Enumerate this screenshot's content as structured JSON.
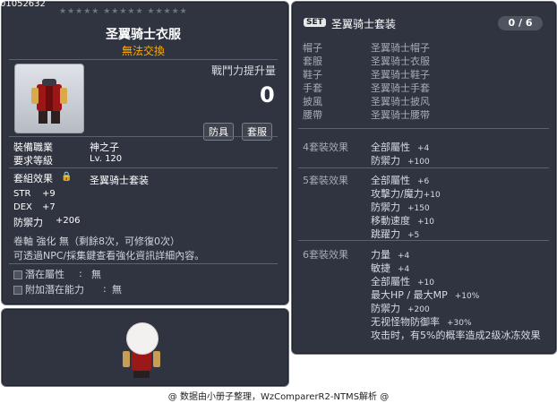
{
  "item": {
    "id": "01052632",
    "title": "圣翼骑士衣服",
    "trade": "無法交換",
    "power_label": "戰鬥力提升量",
    "power_value": "0",
    "chips": [
      "防具",
      "套服"
    ],
    "job_label": "裝備職業",
    "job_value": "神之子",
    "level_label": "要求等級",
    "level_value": "Lv. 120",
    "set_label": "套組效果",
    "set_value": "圣翼骑士套装",
    "stats": [
      {
        "name": "STR",
        "value": "+9"
      },
      {
        "name": "DEX",
        "value": "+7"
      },
      {
        "name": "防禦力",
        "value": "+206"
      }
    ],
    "scroll_line": "卷軸 強化 無（剩餘8次，可修復0次）",
    "npc_line": "可透過NPC/採集鍵查看強化資訊詳細內容。",
    "potential": [
      {
        "label": "潛在屬性",
        "value": "無"
      },
      {
        "label": "附加潛在能力",
        "value": "無"
      }
    ]
  },
  "set": {
    "badge": "SET",
    "title": "圣翼骑士套装",
    "count": "0 / 6",
    "pieces": [
      {
        "slot": "帽子",
        "name": "圣翼骑士帽子"
      },
      {
        "slot": "套服",
        "name": "圣翼骑士衣服"
      },
      {
        "slot": "鞋子",
        "name": "圣翼骑士鞋子"
      },
      {
        "slot": "手套",
        "name": "圣翼骑士手套"
      },
      {
        "slot": "披風",
        "name": "圣翼骑士披风"
      },
      {
        "slot": "腰帶",
        "name": "圣翼骑士腰带"
      }
    ],
    "effects": [
      {
        "head": "4套裝效果",
        "rows": [
          {
            "name": "全部屬性",
            "value": "+4"
          },
          {
            "name": "防禦力",
            "value": "+100"
          }
        ]
      },
      {
        "head": "5套裝效果",
        "rows": [
          {
            "name": "全部屬性",
            "value": "+6"
          },
          {
            "name": "攻擊力/魔力",
            "value": "+10"
          },
          {
            "name": "防禦力",
            "value": "+150"
          },
          {
            "name": "移動速度",
            "value": "+10"
          },
          {
            "name": "跳躍力",
            "value": "+5"
          }
        ]
      },
      {
        "head": "6套裝效果",
        "rows": [
          {
            "name": "力量",
            "value": "+4"
          },
          {
            "name": "敏捷",
            "value": "+4"
          },
          {
            "name": "全部屬性",
            "value": "+10"
          },
          {
            "name": "最大HP / 最大MP",
            "value": "+10%"
          },
          {
            "name": "防禦力",
            "value": "+200"
          },
          {
            "name": "无视怪物防御率",
            "value": "+30%"
          },
          {
            "name": "攻击时，有5%的概率造成2级冰冻效果",
            "value": ""
          }
        ]
      }
    ]
  },
  "footer": "@ 数据由小册子整理，WzComparerR2-NTMS解析 @",
  "colors": {
    "panel_bg": "#2f3440",
    "trade_orange": "#ffaa00",
    "muted_text": "#a5abb5"
  }
}
